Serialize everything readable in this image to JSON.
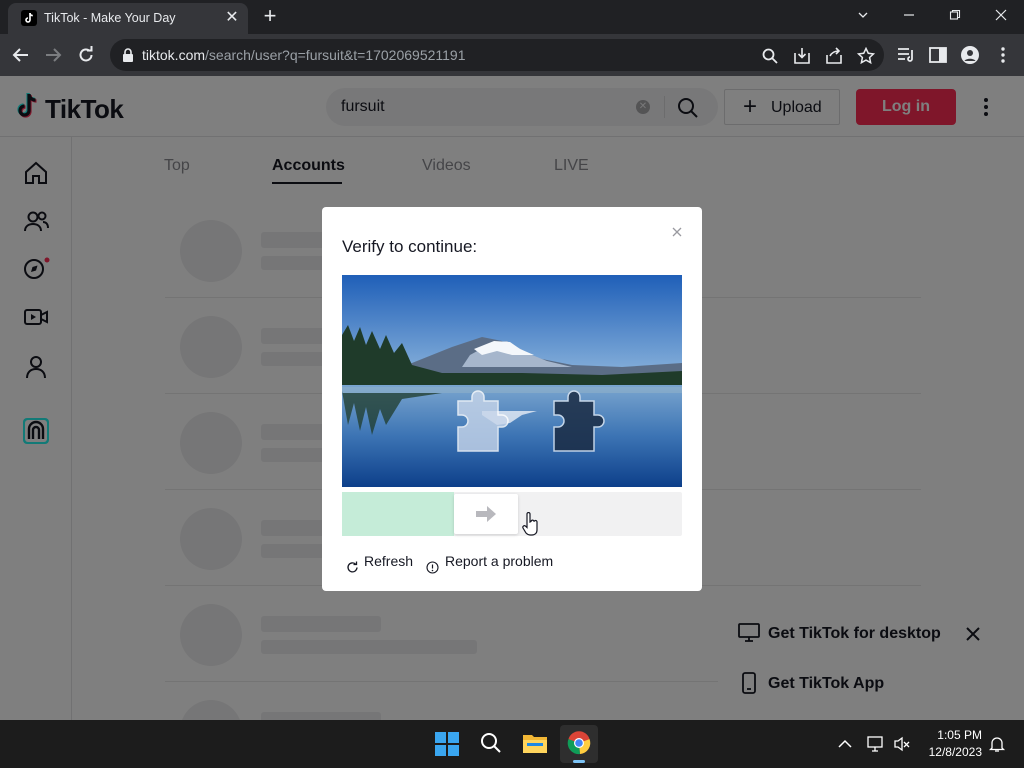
{
  "browser": {
    "tab_title": "TikTok - Make Your Day",
    "tab_close": "✕",
    "new_tab": "+",
    "url_host": "tiktok.com",
    "url_path": "/search/user?q=fursuit&t=1702069521191"
  },
  "header": {
    "logo": "TikTok",
    "search_value": "fursuit",
    "upload_label": "Upload",
    "login_label": "Log in"
  },
  "tabs": [
    "Top",
    "Accounts",
    "Videos",
    "LIVE"
  ],
  "active_tab": "Accounts",
  "modal": {
    "title": "Verify to continue:",
    "refresh_label": "Refresh",
    "report_label": "Report a problem",
    "slider_progress": 0.33
  },
  "getapp": {
    "desktop_label": "Get TikTok for desktop",
    "app_label": "Get TikTok App"
  },
  "taskbar": {
    "time": "1:05 PM",
    "date": "12/8/2023"
  },
  "colors": {
    "brand": "#fe2c55",
    "slider_fill": "#c5ecd8"
  }
}
